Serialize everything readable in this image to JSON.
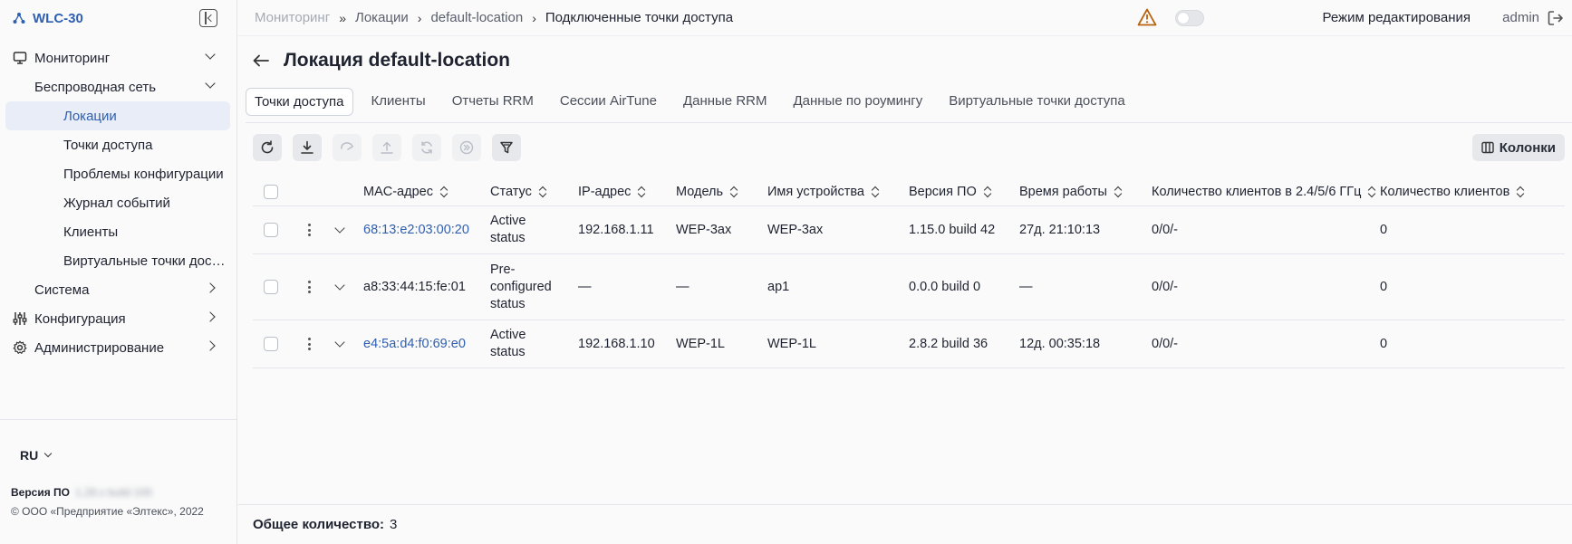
{
  "brand": {
    "name": "WLC-30"
  },
  "sidebar": {
    "items": [
      {
        "label": "Мониторинг"
      },
      {
        "label": "Беспроводная сеть"
      },
      {
        "label": "Локации"
      },
      {
        "label": "Точки доступа"
      },
      {
        "label": "Проблемы конфигурации"
      },
      {
        "label": "Журнал событий"
      },
      {
        "label": "Клиенты"
      },
      {
        "label": "Виртуальные точки доступа"
      },
      {
        "label": "Система"
      },
      {
        "label": "Конфигурация"
      },
      {
        "label": "Администрирование"
      }
    ],
    "language": "RU",
    "version_label": "Версия ПО",
    "version_value": "1.28.x build 100",
    "copyright": "© ООО «Предприятие «Элтекс», 2022"
  },
  "breadcrumb": {
    "items": [
      "Мониторинг",
      "Локации",
      "default-location",
      "Подключенные точки доступа"
    ]
  },
  "header": {
    "edit_mode_label": "Режим редактирования",
    "user": "admin"
  },
  "page": {
    "title": "Локация default-location"
  },
  "tabs": [
    {
      "label": "Точки доступа",
      "active": true
    },
    {
      "label": "Клиенты"
    },
    {
      "label": "Отчеты RRM"
    },
    {
      "label": "Сессии AirTune"
    },
    {
      "label": "Данные RRM"
    },
    {
      "label": "Данные по роумингу"
    },
    {
      "label": "Виртуальные точки доступа"
    }
  ],
  "toolbar": {
    "icons": [
      "refresh-icon",
      "download-icon",
      "reboot-icon",
      "upload-icon",
      "sync-icon",
      "skip-icon",
      "filter-icon"
    ],
    "columns_label": "Колонки"
  },
  "table": {
    "columns": [
      "MAC-адрес",
      "Статус",
      "IP-адрес",
      "Модель",
      "Имя устройства",
      "Версия ПО",
      "Время работы",
      "Количество клиентов в 2.4/5/6 ГГц",
      "Количество клиентов"
    ],
    "rows": [
      {
        "mac": "68:13:e2:03:00:20",
        "status": "Active status",
        "ip": "192.168.1.11",
        "model": "WEP-3ax",
        "name": "WEP-3ax",
        "version": "1.15.0 build 42",
        "uptime": "27д. 21:10:13",
        "clients_bands": "0/0/-",
        "clients": "0"
      },
      {
        "mac": "a8:33:44:15:fe:01",
        "status": "Pre-configured status",
        "ip": "—",
        "model": "—",
        "name": "ap1",
        "version": "0.0.0 build 0",
        "uptime": "—",
        "clients_bands": "0/0/-",
        "clients": "0"
      },
      {
        "mac": "e4:5a:d4:f0:69:e0",
        "status": "Active status",
        "ip": "192.168.1.10",
        "model": "WEP-1L",
        "name": "WEP-1L",
        "version": "2.8.2 build 36",
        "uptime": "12д. 00:35:18",
        "clients_bands": "0/0/-",
        "clients": "0"
      }
    ]
  },
  "footer": {
    "total_label": "Общее количество:",
    "total_value": "3"
  },
  "colors": {
    "accent": "#2e5fb0",
    "warning": "#b8630f"
  }
}
